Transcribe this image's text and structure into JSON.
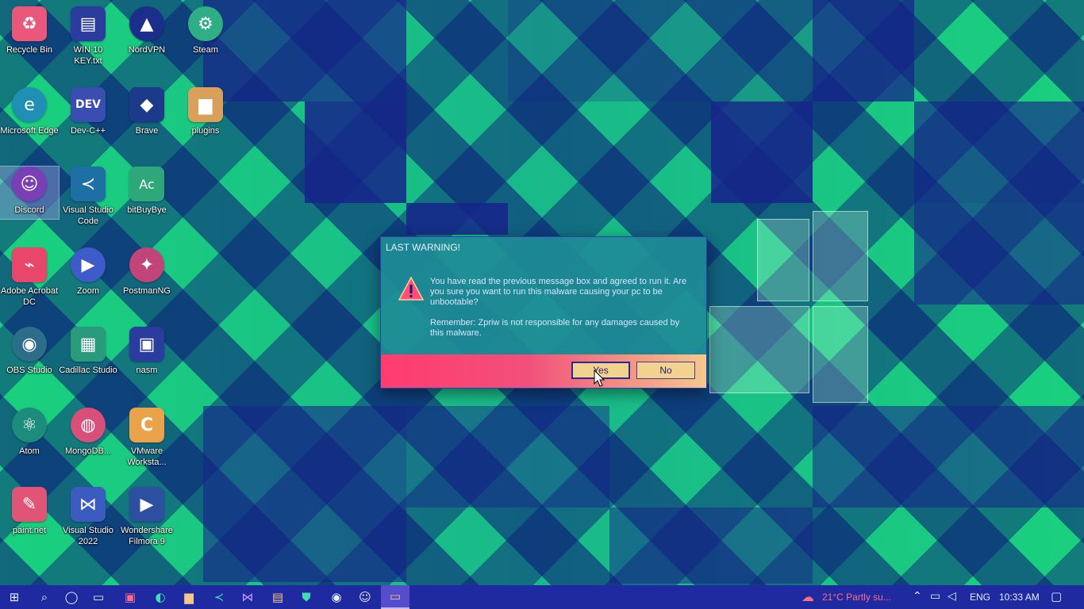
{
  "desktop": {
    "icons": [
      {
        "label": "Recycle Bin",
        "name": "recycle-bin-icon",
        "glyph": "♻",
        "color": "#e9577a"
      },
      {
        "label": "WIN 10 KEY.txt",
        "name": "text-file-icon",
        "glyph": "▤",
        "color": "#2a3c9e"
      },
      {
        "label": "NordVPN",
        "name": "nordvpn-icon",
        "glyph": "▲",
        "color": "#1a2f8a"
      },
      {
        "label": "Steam",
        "name": "steam-icon",
        "glyph": "⚙",
        "color": "#2fae86"
      },
      {
        "label": "Microsoft Edge",
        "name": "edge-icon",
        "glyph": "e",
        "color": "#1f8fb4"
      },
      {
        "label": "Dev-C++",
        "name": "devcpp-icon",
        "glyph": "DEV",
        "color": "#3a4db0"
      },
      {
        "label": "Brave",
        "name": "brave-icon",
        "glyph": "◆",
        "color": "#1b3b8a"
      },
      {
        "label": "plugins",
        "name": "folder-icon",
        "glyph": "▆",
        "color": "#d8a05a"
      },
      {
        "label": "Discord",
        "name": "discord-icon",
        "glyph": "☺",
        "color": "#7a3fb5"
      },
      {
        "label": "Visual Studio Code",
        "name": "vscode-icon",
        "glyph": "≺",
        "color": "#1e6fa6"
      },
      {
        "label": "bitBuyBye",
        "name": "app-icon",
        "glyph": "Ac",
        "color": "#2ea87a"
      },
      {
        "label": "Adobe Acrobat DC",
        "name": "acrobat-icon",
        "glyph": "⌁",
        "color": "#e8466a"
      },
      {
        "label": "Zoom",
        "name": "zoom-icon",
        "glyph": "▶",
        "color": "#3d5bc9"
      },
      {
        "label": "PostmanNG",
        "name": "postman-icon",
        "glyph": "✦",
        "color": "#c2457a"
      },
      {
        "label": "OBS Studio",
        "name": "obs-icon",
        "glyph": "◉",
        "color": "#2c6e8a"
      },
      {
        "label": "Cadillac Studio",
        "name": "chip-icon",
        "glyph": "▦",
        "color": "#2a9a7d"
      },
      {
        "label": "nasm",
        "name": "nasm-icon",
        "glyph": "▣",
        "color": "#2a3c9e"
      },
      {
        "label": "Atom",
        "name": "atom-icon",
        "glyph": "⚛",
        "color": "#1c8d7c"
      },
      {
        "label": "MongoDB...",
        "name": "mongodb-icon",
        "glyph": "◍",
        "color": "#d8507a"
      },
      {
        "label": "VMware Worksta...",
        "name": "vmware-icon",
        "glyph": "C",
        "color": "#e9a34a"
      },
      {
        "label": "paint.net",
        "name": "paintnet-icon",
        "glyph": "✎",
        "color": "#e05577"
      },
      {
        "label": "Visual Studio 2022",
        "name": "visual-studio-icon",
        "glyph": "⋈",
        "color": "#3a5bc0"
      },
      {
        "label": "Wondershare Filmora 9",
        "name": "filmora-icon",
        "glyph": "▶",
        "color": "#2c4fa0"
      }
    ]
  },
  "dialog": {
    "title": "LAST WARNING!",
    "message1": "You have read the previous message box and agreed to run it. Are you sure you want to run this malware causing your pc to be unbootable?",
    "message2": "Remember: Zpriw is not responsible for any damages caused by this malware.",
    "yes_label": "Yes",
    "no_label": "No"
  },
  "taskbar": {
    "weather": "21°C  Partly su...",
    "language": "ENG",
    "time": "10:33 AM"
  }
}
